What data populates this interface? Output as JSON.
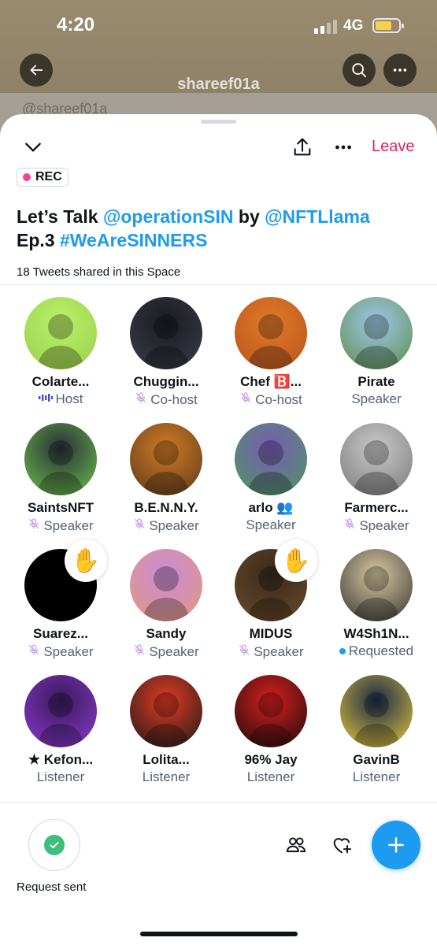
{
  "status": {
    "time": "4:20",
    "network": "4G"
  },
  "profile_bg": {
    "display_name": "shareef01a",
    "handle_partial": "@shareef01a"
  },
  "space": {
    "rec_label": "REC",
    "title_parts": [
      "Let’s Talk ",
      "@operationSIN",
      " by ",
      "@NFTLlama",
      " Ep.3 ",
      "#WeAreSINNERS"
    ],
    "tweets_shared": "18 Tweets shared in this Space",
    "leave_label": "Leave"
  },
  "participants": [
    {
      "name": "Colarte...",
      "role": "Host",
      "mic": "wave",
      "avatar_colors": [
        "#b9f06b",
        "#9ad04a"
      ],
      "avatar_icon": "paper-bag-face"
    },
    {
      "name": "Chuggin...",
      "role": "Co-host",
      "mic": "muted",
      "avatar_colors": [
        "#1a1c22",
        "#3a3d48"
      ],
      "avatar_icon": "character-portrait"
    },
    {
      "name": "Chef 🅱️...",
      "role": "Co-host",
      "mic": "muted",
      "avatar_colors": [
        "#e07a2a",
        "#b8531a"
      ],
      "avatar_icon": "silhouette"
    },
    {
      "name": "Pirate",
      "role": "Speaker",
      "mic": "none",
      "avatar_colors": [
        "#9fc6e8",
        "#5b8f4a"
      ],
      "avatar_icon": "anime-character"
    },
    {
      "name": "SaintsNFT",
      "role": "Speaker",
      "mic": "muted",
      "avatar_colors": [
        "#2a2f3a",
        "#6cc24a"
      ],
      "avatar_icon": "pixel-character"
    },
    {
      "name": "B.E.N.N.Y.",
      "role": "Speaker",
      "mic": "muted",
      "avatar_colors": [
        "#d07a24",
        "#5a3a1c"
      ],
      "avatar_icon": "cartoon-man"
    },
    {
      "name": "arlo 👥",
      "role": "Speaker",
      "mic": "none",
      "avatar_colors": [
        "#7a5ab8",
        "#4a9a5a"
      ],
      "avatar_icon": "robot-frog"
    },
    {
      "name": "Farmerc...",
      "role": "Speaker",
      "mic": "muted",
      "avatar_colors": [
        "#c9c9c9",
        "#7a7a7a"
      ],
      "avatar_icon": "person-portrait"
    },
    {
      "name": "Suarez...",
      "role": "Speaker",
      "mic": "muted",
      "avatar_colors": [
        "#000000",
        "#000000"
      ],
      "avatar_icon": "r-flag-logo",
      "hand": true
    },
    {
      "name": "Sandy",
      "role": "Speaker",
      "mic": "muted",
      "avatar_colors": [
        "#c98ad8",
        "#e39a7a"
      ],
      "avatar_icon": "mint-hair-woman"
    },
    {
      "name": "MIDUS",
      "role": "Speaker",
      "mic": "muted",
      "avatar_colors": [
        "#3a2a1c",
        "#6a4a2a"
      ],
      "avatar_icon": "cartoon-boy",
      "hand": true
    },
    {
      "name": "W4Sh1N...",
      "role": "Requested",
      "mic": "dot",
      "avatar_colors": [
        "#d8c8a0",
        "#333333"
      ],
      "avatar_icon": "masked-face"
    },
    {
      "name": "★ Kefon...",
      "role": "Listener",
      "mic": "none",
      "avatar_colors": [
        "#3a1a5a",
        "#8a3ad0"
      ],
      "avatar_icon": "hooded-figure"
    },
    {
      "name": "Lolita...",
      "role": "Listener",
      "mic": "none",
      "avatar_colors": [
        "#e23a22",
        "#1a1a1a"
      ],
      "avatar_icon": "ninja"
    },
    {
      "name": "96% Jay",
      "role": "Listener",
      "mic": "none",
      "avatar_colors": [
        "#d61f1f",
        "#1a0a0a"
      ],
      "avatar_icon": "silhouette-hands"
    },
    {
      "name": "GavinB",
      "role": "Listener",
      "mic": "none",
      "avatar_colors": [
        "#1a2a4a",
        "#e8c93a"
      ],
      "avatar_icon": "robot-face"
    }
  ],
  "bottom": {
    "request_label": "Request sent"
  },
  "colors": {
    "accent": "#1d9bf0",
    "leave": "#e0245e",
    "rec_dot": "#f0468d",
    "success": "#3bbf7a"
  }
}
